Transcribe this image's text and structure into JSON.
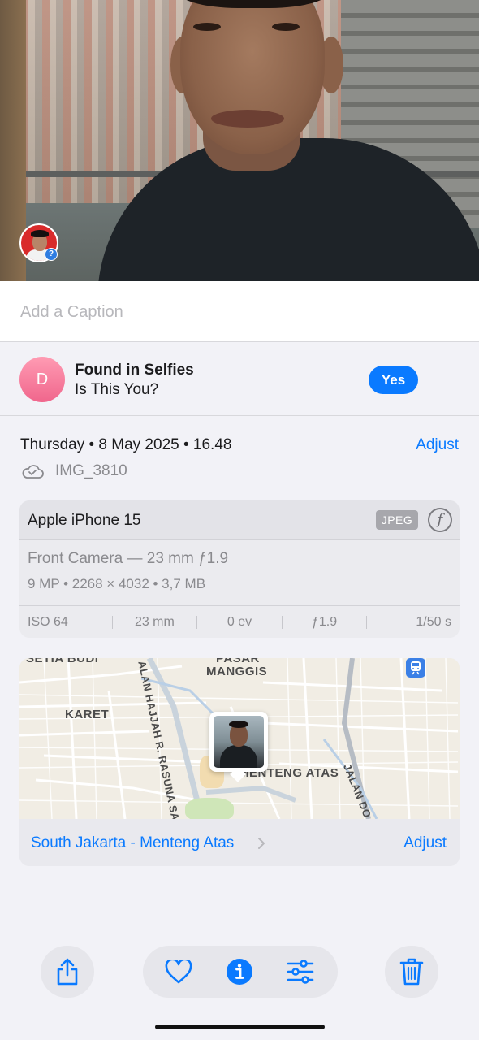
{
  "photo": {
    "people_badge": "?"
  },
  "caption": {
    "placeholder": "Add a Caption"
  },
  "face_suggestion": {
    "avatar_initial": "D",
    "title": "Found in Selfies",
    "question": "Is This You?",
    "yes_label": "Yes"
  },
  "info": {
    "date": "Thursday • 8 May 2025 • 16.48",
    "adjust_label": "Adjust",
    "filename": "IMG_3810"
  },
  "camera": {
    "device": "Apple iPhone 15",
    "format_badge": "JPEG",
    "lens": "Front Camera — 23 mm ƒ1.9",
    "specs": "9 MP  •  2268 × 4032  •  3,7 MB",
    "exif": [
      "ISO 64",
      "23 mm",
      "0 ev",
      "ƒ1.9",
      "1/50 s"
    ]
  },
  "map": {
    "labels": {
      "top": "SETIA BUDI",
      "pasar": "PASAR",
      "manggis": "MANGGIS",
      "karet": "KARET",
      "rasuna": "ALAN HAJJAH R. RASUNA SA",
      "menteng": "MENTENG ATAS",
      "jalan_dr": "JALAN DO"
    },
    "location": "South Jakarta - Menteng Atas",
    "adjust_label": "Adjust"
  },
  "colors": {
    "accent": "#0a7aff",
    "background": "#f2f2f7"
  },
  "toolbar": {
    "icons": [
      "share-icon",
      "heart-icon",
      "info-icon",
      "adjust-icon",
      "trash-icon"
    ]
  }
}
